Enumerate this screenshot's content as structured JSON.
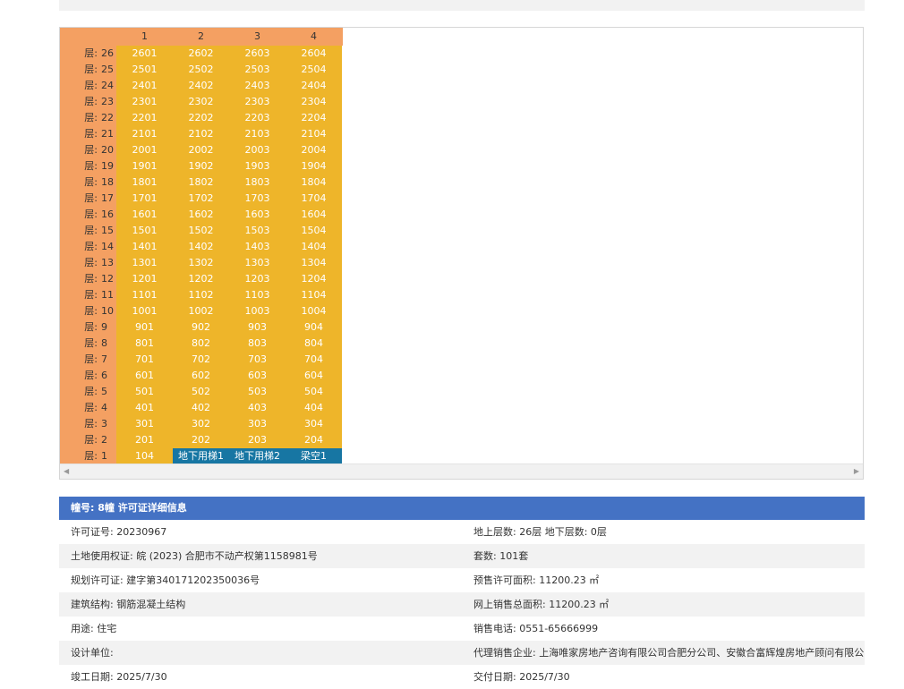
{
  "grid": {
    "units": [
      "1",
      "2",
      "3",
      "4"
    ],
    "floor_prefix": "层:",
    "floors": [
      {
        "floor": "26",
        "rooms": [
          "2601",
          "2602",
          "2603",
          "2604"
        ]
      },
      {
        "floor": "25",
        "rooms": [
          "2501",
          "2502",
          "2503",
          "2504"
        ]
      },
      {
        "floor": "24",
        "rooms": [
          "2401",
          "2402",
          "2403",
          "2404"
        ]
      },
      {
        "floor": "23",
        "rooms": [
          "2301",
          "2302",
          "2303",
          "2304"
        ]
      },
      {
        "floor": "22",
        "rooms": [
          "2201",
          "2202",
          "2203",
          "2204"
        ]
      },
      {
        "floor": "21",
        "rooms": [
          "2101",
          "2102",
          "2103",
          "2104"
        ]
      },
      {
        "floor": "20",
        "rooms": [
          "2001",
          "2002",
          "2003",
          "2004"
        ]
      },
      {
        "floor": "19",
        "rooms": [
          "1901",
          "1902",
          "1903",
          "1904"
        ]
      },
      {
        "floor": "18",
        "rooms": [
          "1801",
          "1802",
          "1803",
          "1804"
        ]
      },
      {
        "floor": "17",
        "rooms": [
          "1701",
          "1702",
          "1703",
          "1704"
        ]
      },
      {
        "floor": "16",
        "rooms": [
          "1601",
          "1602",
          "1603",
          "1604"
        ]
      },
      {
        "floor": "15",
        "rooms": [
          "1501",
          "1502",
          "1503",
          "1504"
        ]
      },
      {
        "floor": "14",
        "rooms": [
          "1401",
          "1402",
          "1403",
          "1404"
        ]
      },
      {
        "floor": "13",
        "rooms": [
          "1301",
          "1302",
          "1303",
          "1304"
        ]
      },
      {
        "floor": "12",
        "rooms": [
          "1201",
          "1202",
          "1203",
          "1204"
        ]
      },
      {
        "floor": "11",
        "rooms": [
          "1101",
          "1102",
          "1103",
          "1104"
        ]
      },
      {
        "floor": "10",
        "rooms": [
          "1001",
          "1002",
          "1003",
          "1004"
        ]
      },
      {
        "floor": "9",
        "rooms": [
          "901",
          "902",
          "903",
          "904"
        ]
      },
      {
        "floor": "8",
        "rooms": [
          "801",
          "802",
          "803",
          "804"
        ]
      },
      {
        "floor": "7",
        "rooms": [
          "701",
          "702",
          "703",
          "704"
        ]
      },
      {
        "floor": "6",
        "rooms": [
          "601",
          "602",
          "603",
          "604"
        ]
      },
      {
        "floor": "5",
        "rooms": [
          "501",
          "502",
          "503",
          "504"
        ]
      },
      {
        "floor": "4",
        "rooms": [
          "401",
          "402",
          "403",
          "404"
        ]
      },
      {
        "floor": "3",
        "rooms": [
          "301",
          "302",
          "303",
          "304"
        ]
      },
      {
        "floor": "2",
        "rooms": [
          "201",
          "202",
          "203",
          "204"
        ]
      },
      {
        "floor": "1",
        "rooms": [
          "104",
          "地下用梯1",
          "地下用梯2",
          "梁空1"
        ],
        "special": [
          false,
          true,
          true,
          true
        ]
      }
    ],
    "colors": {
      "label_bg": "#f4a062",
      "room_bg": "#eeb52a",
      "special_bg": "#1776a3"
    }
  },
  "info": {
    "header": "幢号: 8幢 许可证详细信息",
    "rows": [
      [
        "许可证号: 20230967",
        "地上层数: 26层 地下层数: 0层"
      ],
      [
        "土地使用权证: 皖 (2023) 合肥市不动产权第1158981号",
        "套数: 101套"
      ],
      [
        "规划许可证: 建字第340171202350036号",
        "预售许可面积: 11200.23 ㎡"
      ],
      [
        "建筑结构: 钢筋混凝土结构",
        "网上销售总面积: 11200.23 ㎡"
      ],
      [
        "用途: 住宅",
        "销售电话: 0551-65666999"
      ],
      [
        "设计单位:",
        "代理销售企业: 上海唯家房地产咨询有限公司合肥分公司、安徽合富辉煌房地产顾问有限公"
      ],
      [
        "竣工日期: 2025/7/30",
        "交付日期: 2025/7/30"
      ]
    ],
    "header_color": "#4472c4"
  },
  "scrollbar": {
    "left_arrow": "◀",
    "right_arrow": "▶"
  }
}
